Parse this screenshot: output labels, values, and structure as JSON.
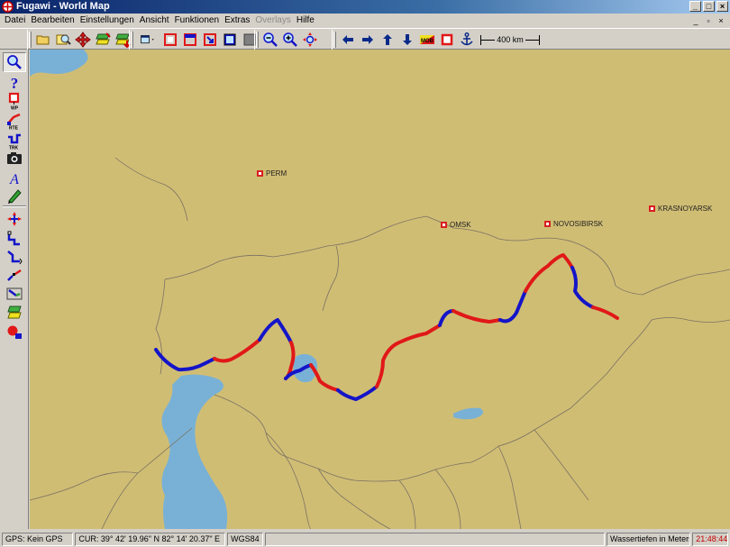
{
  "window": {
    "title": "Fugawi - World Map"
  },
  "menu": {
    "items": [
      {
        "label": "Datei",
        "enabled": true
      },
      {
        "label": "Bearbeiten",
        "enabled": true
      },
      {
        "label": "Einstellungen",
        "enabled": true
      },
      {
        "label": "Ansicht",
        "enabled": true
      },
      {
        "label": "Funktionen",
        "enabled": true
      },
      {
        "label": "Extras",
        "enabled": true
      },
      {
        "label": "Overlays",
        "enabled": false
      },
      {
        "label": "Hilfe",
        "enabled": true
      }
    ]
  },
  "toolbar": {
    "scale_label": "400 km",
    "buttons": [
      "open-map-icon",
      "find-map-icon",
      "pan-icon",
      "layers-icon",
      "layers-down-icon",
      "view-window-icon",
      "box-icon",
      "box-select-icon",
      "box-arrow-icon",
      "screen-icon",
      "zoom-out-icon",
      "zoom-in-icon",
      "zoom-fit-icon",
      "arrow-left-icon",
      "arrow-right-icon",
      "arrow-up-icon",
      "arrow-down-icon",
      "mob-icon",
      "square-mark-icon",
      "anchor-icon"
    ]
  },
  "left_toolbar": {
    "buttons": [
      "magnifier-icon",
      "help-icon",
      "waypoint-icon",
      "route-icon",
      "track-icon",
      "camera-icon",
      "text-icon",
      "pen-icon",
      "move-waypoint-icon",
      "track-edit-icon",
      "track-join-icon",
      "track-split-icon",
      "route-edit-icon",
      "layer-icon",
      "gps-position-icon"
    ]
  },
  "map": {
    "land_color": "#d0bd74",
    "water_color": "#79b1d6",
    "border_color": "#7a7262",
    "track_colors": [
      "#1414c8",
      "#e01818"
    ],
    "cities": [
      {
        "name": "PERM"
      },
      {
        "name": "OMSK"
      },
      {
        "name": "NOVOSIBIRSK"
      },
      {
        "name": "KRASNOYARSK"
      }
    ]
  },
  "status": {
    "gps": "GPS: Kein GPS",
    "cursor": "CUR: 39° 42' 19.96\" N 82° 14' 20.37\" E",
    "datum": "WGS84",
    "depth": "Wassertiefen in Meters",
    "clock": "21:48:44"
  }
}
